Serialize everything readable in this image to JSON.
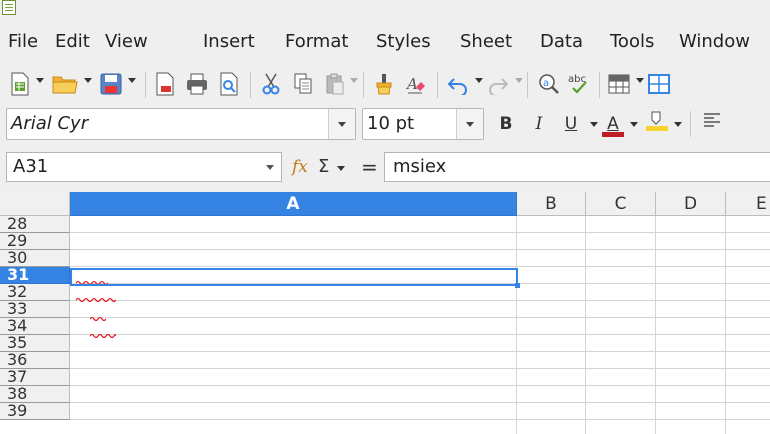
{
  "window": {
    "app_icon": "calc-spreadsheet-icon"
  },
  "menu": [
    "File",
    "Edit",
    "View",
    "Insert",
    "Format",
    "Styles",
    "Sheet",
    "Data",
    "Tools",
    "Window"
  ],
  "toolbar_icons": [
    "new-document-icon",
    "open-folder-icon",
    "save-icon",
    "export-pdf-icon",
    "print-icon",
    "print-preview-icon",
    "cut-icon",
    "copy-icon",
    "paste-icon",
    "clone-formatting-icon",
    "clear-formatting-icon",
    "undo-icon",
    "redo-icon",
    "find-replace-icon",
    "spellcheck-icon",
    "table-grid-icon",
    "borders-icon"
  ],
  "spellcheck_label": "abc",
  "format": {
    "font_name": "Arial Cyr",
    "font_size": "10 pt",
    "bold_label": "B",
    "italic_label": "I",
    "underline_label": "U",
    "font_color_label": "A",
    "font_color": "#c01c28",
    "highlight_color": "#f6d32d"
  },
  "formula_bar": {
    "cell_reference": "A31",
    "fx_label": "fx",
    "sigma_label": "Σ",
    "equals_label": "=",
    "content": "msiex"
  },
  "sheet": {
    "columns": [
      "A",
      "B",
      "C",
      "D",
      "E"
    ],
    "selected_column": "A",
    "rows": [
      "28",
      "29",
      "30",
      "31",
      "32",
      "33",
      "34",
      "35",
      "36",
      "37",
      "38",
      "39"
    ],
    "selected_row": "31",
    "accent_color": "#3584e4"
  }
}
